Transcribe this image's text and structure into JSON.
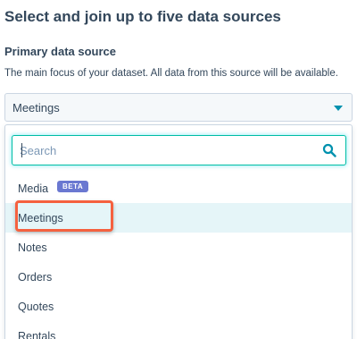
{
  "header": {
    "title": "Select and join up to five data sources"
  },
  "primary_source": {
    "label": "Primary data source",
    "description": "The main focus of your dataset. All data from this source will be available.",
    "selected_value": "Meetings"
  },
  "dropdown": {
    "search_placeholder": "Search",
    "items": [
      {
        "label": "Media",
        "badge": "BETA"
      },
      {
        "label": "Meetings",
        "selected": true
      },
      {
        "label": "Notes"
      },
      {
        "label": "Orders"
      },
      {
        "label": "Quotes"
      },
      {
        "label": "Rentals"
      }
    ]
  },
  "colors": {
    "text": "#33475b",
    "accent": "#0091ae",
    "focus": "#00bda5",
    "selected_bg": "#e5f5f8",
    "badge_bg": "#6a78d1",
    "annotation": "#f5613f"
  },
  "icons": {
    "search": "search-icon",
    "dropdown": "caret-down-icon"
  }
}
